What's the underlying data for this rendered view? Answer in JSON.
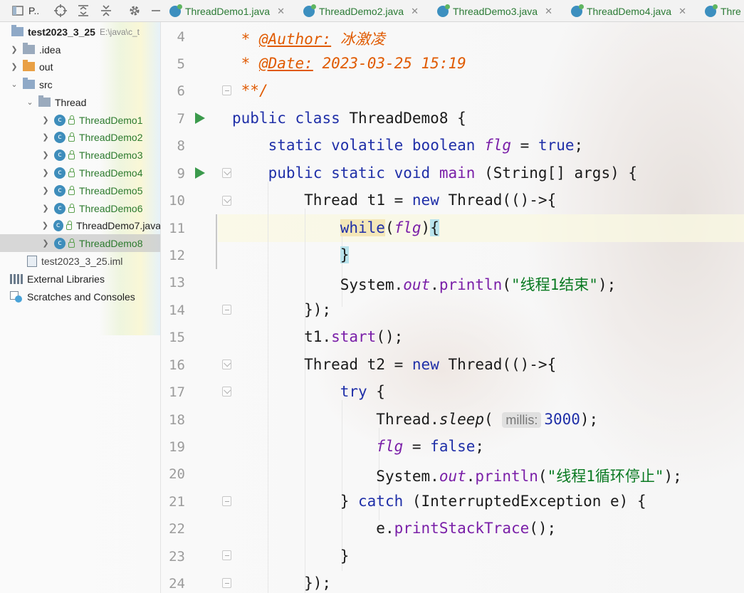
{
  "project_toolbar": {
    "label": "P..",
    "icons": [
      "crosshair-icon",
      "expand-all-icon",
      "collapse-all-icon",
      "gear-icon",
      "minimize-icon"
    ]
  },
  "tabs": [
    {
      "label": "ThreadDemo1.java"
    },
    {
      "label": "ThreadDemo2.java"
    },
    {
      "label": "ThreadDemo3.java"
    },
    {
      "label": "ThreadDemo4.java"
    },
    {
      "label": "Thre"
    }
  ],
  "tree": {
    "project": {
      "name": "test2023_3_25",
      "path": "E:\\java\\c_t"
    },
    "idea": ".idea",
    "out": "out",
    "src": "src",
    "thread_pkg": "Thread",
    "classes": [
      "ThreadDemo1",
      "ThreadDemo2",
      "ThreadDemo3",
      "ThreadDemo4",
      "ThreadDemo5",
      "ThreadDemo6"
    ],
    "demo7": "ThreadDemo7.java",
    "demo8": "ThreadDemo8",
    "iml": "test2023_3_25.iml",
    "ext_libs": "External Libraries",
    "scratches": "Scratches and Consoles"
  },
  "editor": {
    "line_numbers": [
      "4",
      "5",
      "6",
      "7",
      "8",
      "9",
      "10",
      "11",
      "12",
      "13",
      "14",
      "15",
      "16",
      "17",
      "18",
      "19",
      "20",
      "21",
      "22",
      "23",
      "24"
    ],
    "comment": {
      "author_tag": "@Author:",
      "author": "冰激凌",
      "date_tag": "@Date:",
      "date": "2023-03-25 15:19",
      "star": "*",
      "end": "**/"
    },
    "kw": {
      "public": "public",
      "class": "class",
      "static": "static",
      "volatile": "volatile",
      "boolean": "boolean",
      "true": "true",
      "void": "void",
      "new": "new",
      "while": "while",
      "try": "try",
      "false": "false",
      "catch": "catch"
    },
    "ids": {
      "classname": "ThreadDemo8",
      "flg": "flg",
      "main": "main",
      "main_params": "(String[] args) {",
      "thread": "Thread",
      "t1": "t1",
      "t2": "t2",
      "lambda": "(()->{",
      "system": "System",
      "out": "out",
      "println": "println",
      "start": "start",
      "sleep": "sleep",
      "hint_millis": "millis:",
      "millis_value": "3000",
      "exc": "(InterruptedException e) {",
      "e": "e",
      "printstacktrace": "printStackTrace"
    },
    "strings": {
      "s1": "\"线程1结束\"",
      "s2": "\"线程1循环停止\""
    }
  }
}
